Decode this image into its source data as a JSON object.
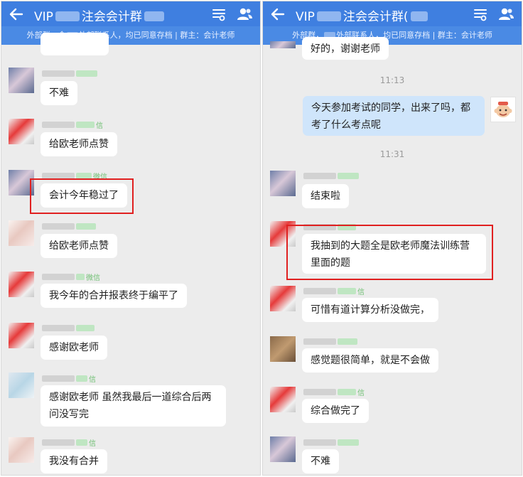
{
  "panels": [
    {
      "header": {
        "title_prefix": "VIP",
        "title_suffix": "注会会计群",
        "subtitle_a": "外部群，含",
        "subtitle_b": "外部联系人，均已同意存档 | 群主：会计老师"
      },
      "messages": [
        {
          "text": ""
        },
        {
          "text": "不难"
        },
        {
          "text": "给欧老师点赞",
          "tag": "信"
        },
        {
          "text": "会计今年稳过了",
          "tag": "微信"
        },
        {
          "text": "给欧老师点赞"
        },
        {
          "text": "我今年的合并报表终于编平了",
          "tag": "微信"
        },
        {
          "text": "感谢欧老师"
        },
        {
          "text": "感谢欧老师 虽然我最后一道综合后两问没写完",
          "tag": "信"
        },
        {
          "text": "我没有合并",
          "tag": "信"
        }
      ]
    },
    {
      "header": {
        "title_prefix": "VIP",
        "title_suffix": "注会会计群(",
        "subtitle_a": "外部群，",
        "subtitle_b": "外部联系人，均已同意存档 | 群主：会计老师"
      },
      "messages": [
        {
          "text": "好的，谢谢老师"
        },
        {
          "timestamp": "11:13"
        },
        {
          "text": "今天参加考试的同学，出来了吗，都考了什么考点呢",
          "self": true
        },
        {
          "timestamp": "11:31"
        },
        {
          "text": "结束啦"
        },
        {
          "text": "我抽到的大题全是欧老师魔法训练营里面的题"
        },
        {
          "text": "可惜有道计算分析没做完，",
          "tag": "信"
        },
        {
          "text": "感觉题很简单，就是不会做"
        },
        {
          "text": "综合做完了",
          "tag": "信"
        },
        {
          "text": "不难"
        }
      ]
    }
  ],
  "icons": {
    "back": "back-arrow-icon",
    "group_settings": "group-settings-icon",
    "members": "members-icon"
  },
  "colors": {
    "titlebar": "#3f7fe0",
    "subbar": "#4a8ae4",
    "chat_background": "#ececec",
    "self_bubble": "#cfe5fb",
    "highlight_box": "#e02020"
  }
}
